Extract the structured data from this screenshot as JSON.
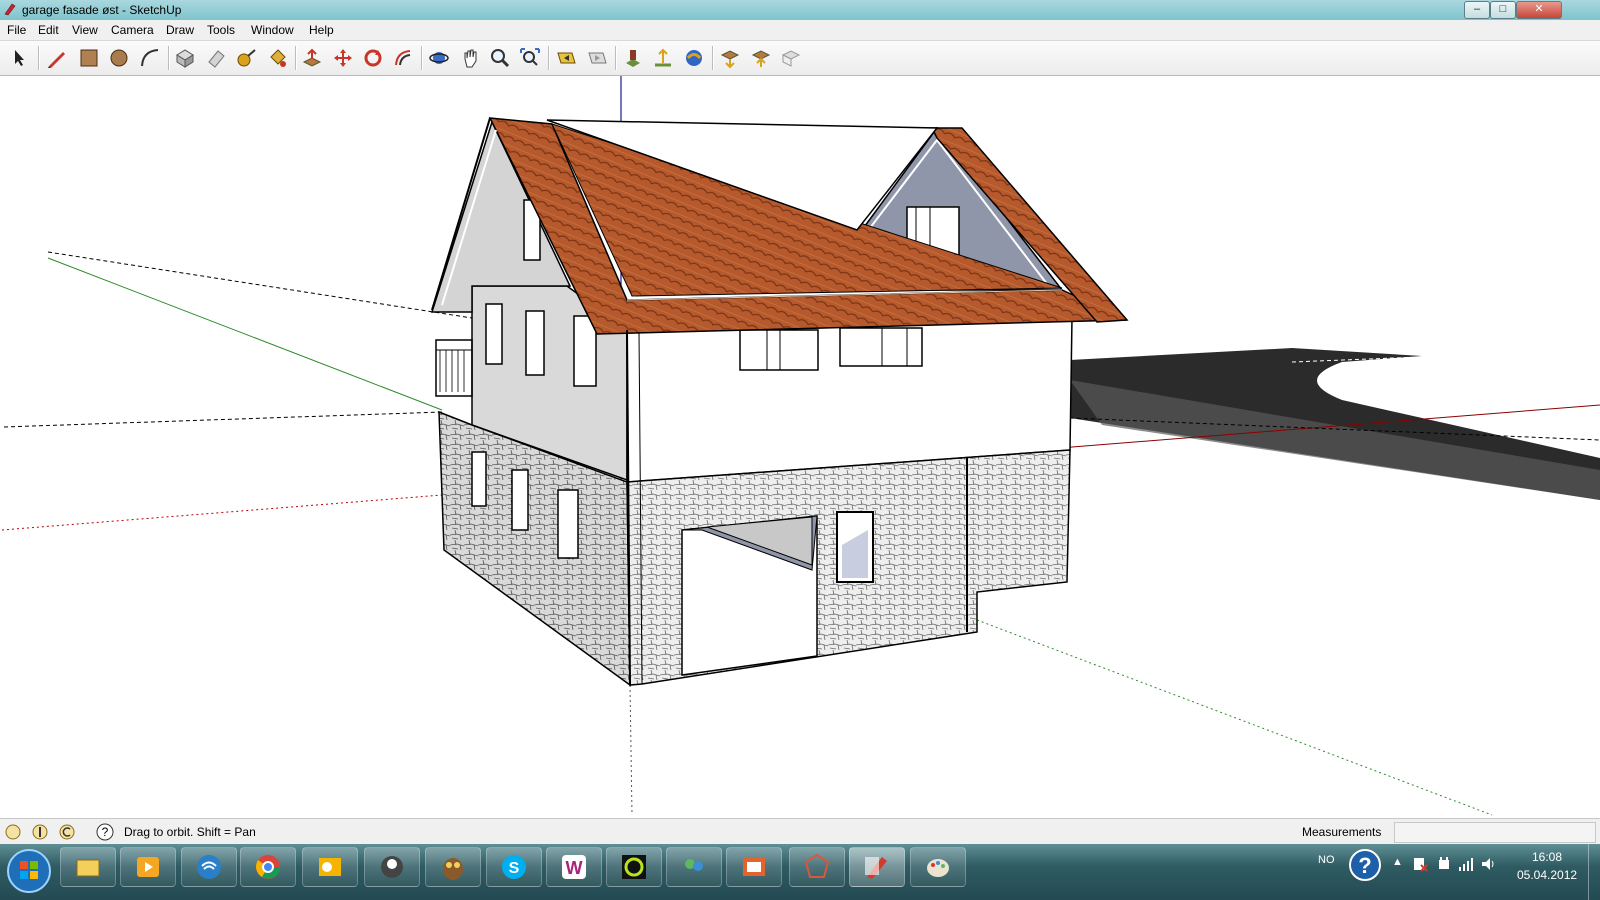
{
  "window": {
    "title": "garage fasade øst - SketchUp",
    "controls": {
      "minimize": "–",
      "maximize": "□",
      "close": "✕"
    }
  },
  "menubar": {
    "items": [
      "File",
      "Edit",
      "View",
      "Camera",
      "Draw",
      "Tools",
      "Window",
      "Help"
    ]
  },
  "toolbar": {
    "tools": [
      "select-tool-icon",
      "pencil-line-tool-icon",
      "rectangle-tool-icon",
      "circle-tool-icon",
      "arc-tool-icon",
      "make-component-icon",
      "eraser-tool-icon",
      "tape-measure-tool-icon",
      "paint-bucket-tool-icon",
      "push-pull-tool-icon",
      "move-tool-icon",
      "rotate-tool-icon",
      "offset-tool-icon",
      "orbit-tool-icon",
      "pan-tool-icon",
      "zoom-tool-icon",
      "zoom-extents-icon",
      "previous-view-icon",
      "next-view-icon",
      "add-location-icon",
      "toggle-terrain-icon",
      "get-models-icon",
      "share-model-icon",
      "get-models-warehouse-icon",
      "share-component-icon",
      "extension-warehouse-icon"
    ]
  },
  "statusbar": {
    "hint": "Drag to orbit.  Shift = Pan",
    "measurements_label": "Measurements",
    "measurements_value": ""
  },
  "taskbar": {
    "apps": [
      "windows-explorer-icon",
      "media-player-icon",
      "network-icon",
      "chrome-icon",
      "outlook-icon",
      "app-icon",
      "owl-app-icon",
      "skype-icon",
      "w-app-icon",
      "circle-app-icon",
      "messenger-icon",
      "photo-app-icon",
      "sketchup-layout-icon",
      "sketchup-icon",
      "paint-icon"
    ],
    "language": "NO",
    "time": "16:08",
    "date": "05.04.2012"
  },
  "colors": {
    "roof": "#b5532b",
    "roof_dark": "#8f3d1c",
    "wall_light": "#ffffff",
    "wall_shade": "#d8d8d8",
    "stone": "#e9e9e9",
    "gable_shade": "#8f96aa",
    "axis_red": "#c00000",
    "axis_green": "#2e8b2e",
    "axis_blue": "#1a1a8c",
    "shadow": "#2b2b2b"
  }
}
